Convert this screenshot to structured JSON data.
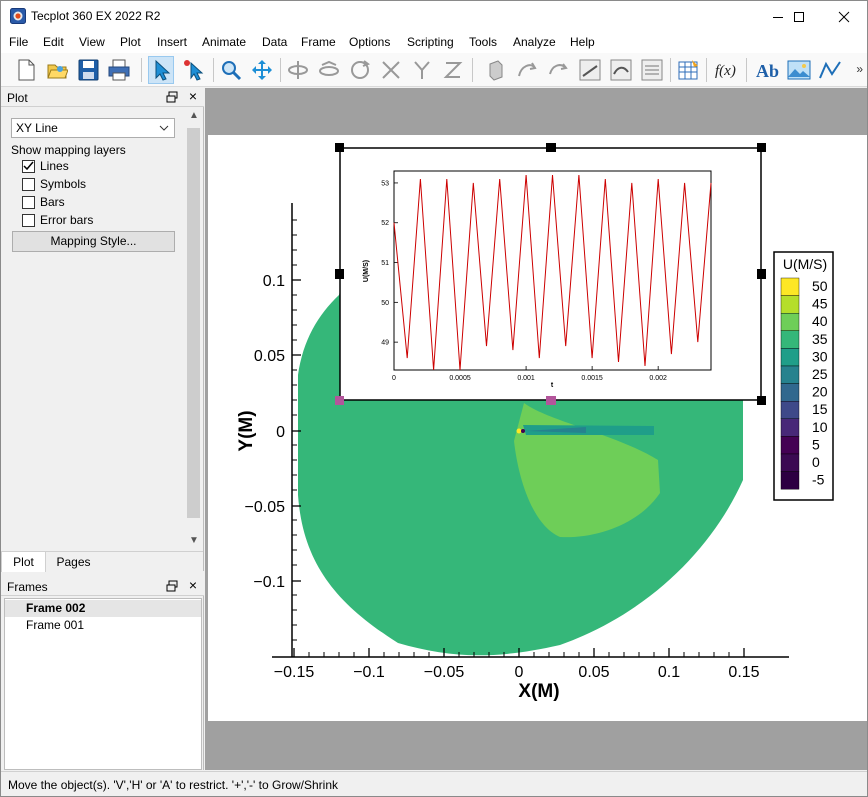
{
  "window": {
    "title": "Tecplot 360 EX 2022 R2"
  },
  "menu": [
    "File",
    "Edit",
    "View",
    "Plot",
    "Insert",
    "Animate",
    "Data",
    "Frame",
    "Options",
    "Scripting",
    "Tools",
    "Analyze",
    "Help"
  ],
  "toolbar": {
    "active_tool": "selector-icon",
    "icons": [
      "new-layout-icon",
      "open-layout-icon",
      "save-icon",
      "print-icon",
      "selector-icon",
      "adjustor-icon",
      "zoom-icon",
      "translate-icon",
      "rotate-x-icon",
      "rotate-y-icon",
      "rotate-z-icon",
      "rotate-xy-icon",
      "rotate-yx-icon",
      "rotate-zz-icon",
      "probe-icon",
      "rollerball-icon",
      "spherical-icon",
      "slice-icon",
      "iso-icon",
      "streamtrace-icon",
      "data-edit-icon",
      "function-icon",
      "text-icon",
      "image-icon",
      "geometry-icon"
    ],
    "more_label": "»"
  },
  "plot_panel": {
    "title": "Plot",
    "plot_type": "XY Line",
    "show_layers_label": "Show mapping layers",
    "layers": [
      {
        "label": "Lines",
        "checked": true
      },
      {
        "label": "Symbols",
        "checked": false
      },
      {
        "label": "Bars",
        "checked": false
      },
      {
        "label": "Error bars",
        "checked": false
      }
    ],
    "mapping_style_button": "Mapping Style..."
  },
  "tabs": {
    "plot": "Plot",
    "pages": "Pages",
    "active": "plot"
  },
  "frames_panel": {
    "title": "Frames",
    "frames": [
      {
        "label": "Frame 002",
        "current": true
      },
      {
        "label": "Frame 001",
        "current": false
      }
    ]
  },
  "contour_plot": {
    "x_title": "X(M)",
    "y_title": "Y(M)",
    "x_ticks": [
      "−0.15",
      "−0.1",
      "−0.05",
      "0",
      "0.05",
      "0.1",
      "0.15"
    ],
    "y_ticks": [
      "0.1",
      "0.05",
      "0",
      "−0.05",
      "−0.1"
    ],
    "legend_title": "U(M/S)",
    "legend_levels": [
      "50",
      "45",
      "40",
      "35",
      "30",
      "25",
      "20",
      "15",
      "10",
      "5",
      "0",
      "-5"
    ],
    "legend_colors": [
      "#fde725",
      "#b5de2b",
      "#6ece58",
      "#35b779",
      "#1f9e89",
      "#26828e",
      "#31688e",
      "#3e4989",
      "#482878",
      "#440154",
      "#3b0a52",
      "#2d0042"
    ],
    "main_fill": "#35b779",
    "light_fill": "#6ece58"
  },
  "chart_data": {
    "type": "line",
    "xlabel": "t",
    "ylabel": "U(M/S)",
    "x_ticks": [
      "0",
      "0.0005",
      "0.001",
      "0.0015",
      "0.002"
    ],
    "y_ticks": [
      "53",
      "52",
      "51",
      "50",
      "49"
    ],
    "xlim": [
      0,
      0.0024
    ],
    "ylim": [
      48.3,
      53.3
    ],
    "series_color": "#cc0000",
    "series": [
      {
        "x": [
          0,
          0.0001,
          0.0002,
          0.0003,
          0.0004,
          0.0005,
          0.0006,
          0.0007,
          0.0008,
          0.0009,
          0.001,
          0.0011,
          0.0012,
          0.0013,
          0.0014,
          0.0015,
          0.0016,
          0.0017,
          0.0018,
          0.0019,
          0.002,
          0.0021,
          0.0022,
          0.0023,
          0.0024
        ],
        "y": [
          52.0,
          48.6,
          53.1,
          48.3,
          53.1,
          48.3,
          53.0,
          48.9,
          53.1,
          48.8,
          53.2,
          48.6,
          53.2,
          48.9,
          53.2,
          48.6,
          53.1,
          48.5,
          53.0,
          48.4,
          53.1,
          48.7,
          53.0,
          49.0,
          53.0
        ]
      }
    ]
  },
  "status": {
    "text": "Move the object(s).  'V','H' or 'A' to restrict.  '+','-' to Grow/Shrink"
  }
}
